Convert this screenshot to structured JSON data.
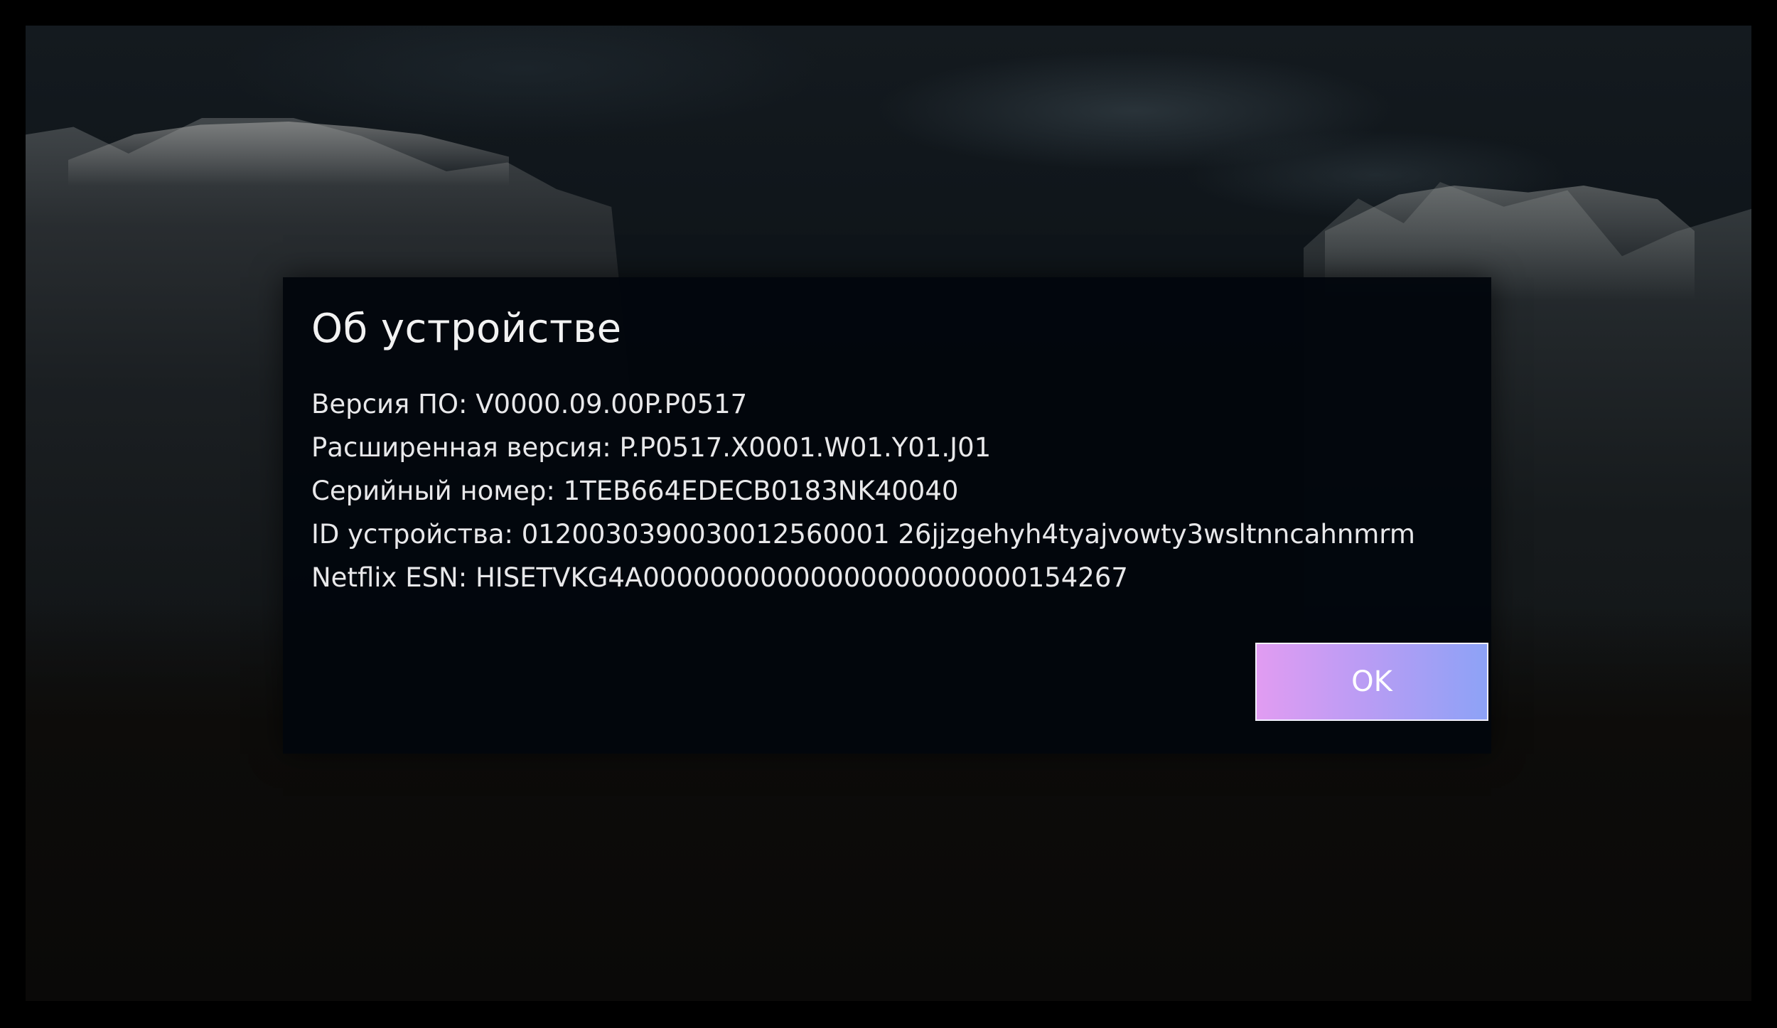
{
  "dialog": {
    "title": "Об устройстве",
    "lines": [
      "Версия ПО: V0000.09.00P.P0517",
      "Расширенная версия: P.P0517.X0001.W01.Y01.J01",
      "Серийный номер: 1TEB664EDECB0183NK40040",
      "ID устройства: 0120030390030012560001 26jjzgehyh4tyajvowty3wsltnncahnmrm",
      "Netflix ESN: HISETVKG4A00000000000000000000000154267"
    ],
    "ok_label": "OK"
  },
  "colors": {
    "dialog_background": "#02060c",
    "ok_gradient_start": "#e19cf2",
    "ok_gradient_end": "#8da2f6"
  }
}
